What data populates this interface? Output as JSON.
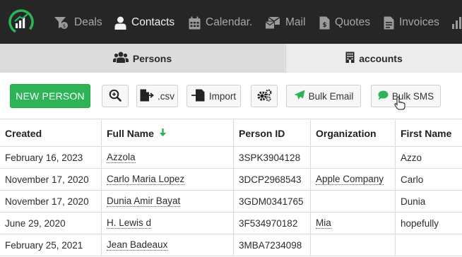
{
  "nav": {
    "items": [
      {
        "label": "Deals",
        "icon": "funnel-dollar-icon"
      },
      {
        "label": "Contacts",
        "icon": "person-icon",
        "active": true
      },
      {
        "label": "Calendar.",
        "icon": "calendar-icon"
      },
      {
        "label": "Mail",
        "icon": "mail-icon"
      },
      {
        "label": "Quotes",
        "icon": "quote-document-icon"
      },
      {
        "label": "Invoices",
        "icon": "invoice-document-icon"
      }
    ]
  },
  "subtabs": {
    "persons": "Persons",
    "accounts": "accounts"
  },
  "toolbar": {
    "new_person": "NEW PERSON",
    "csv": ".csv",
    "import": "Import",
    "bulk_email": "Bulk Email",
    "bulk_sms": "Bulk SMS"
  },
  "table": {
    "columns": [
      "Created",
      "Full Name",
      "Person ID",
      "Organization",
      "First Name"
    ],
    "rows": [
      {
        "created": "February 16, 2023",
        "full_name": "Azzola",
        "person_id": "3SPK3904128",
        "organization": "",
        "first_name": "Azzo"
      },
      {
        "created": "November 17, 2020",
        "full_name": "Carlo Maria Lopez",
        "person_id": "3DCP2968543",
        "organization": "Apple Company",
        "first_name": "Carlo"
      },
      {
        "created": "November 17, 2020",
        "full_name": "Dunia Amir Bayat",
        "person_id": "3GDM0341765",
        "organization": "",
        "first_name": "Dunia"
      },
      {
        "created": "June 29, 2020",
        "full_name": "H. Lewis d",
        "person_id": "3F534970182",
        "organization": "Mia",
        "first_name": "hopefully"
      },
      {
        "created": "February 25, 2021",
        "full_name": "Jean Badeaux",
        "person_id": "3MBA7234098",
        "organization": "",
        "first_name": ""
      }
    ]
  },
  "colors": {
    "nav_bg": "#262626",
    "accent_green": "#2cb457",
    "sort_arrow": "#2cb457"
  }
}
